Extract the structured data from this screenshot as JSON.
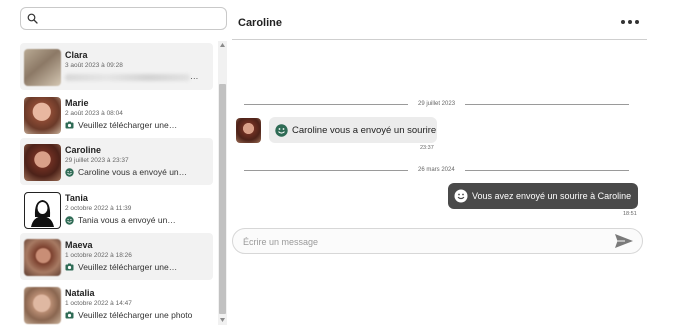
{
  "search": {
    "placeholder": ""
  },
  "conversations": [
    {
      "name": "Clara",
      "date": "3 août 2023 à 09:28",
      "preview": "…",
      "preview_icon": "none",
      "blurred": true,
      "avatar": "photo"
    },
    {
      "name": "Marie",
      "date": "2 août 2023 à 08:04",
      "preview": "Veuillez télécharger une…",
      "preview_icon": "camera-icon",
      "avatar": "photo"
    },
    {
      "name": "Caroline",
      "date": "29 juillet 2023 à 23:37",
      "preview": "Caroline vous a envoyé un…",
      "preview_icon": "smiley-icon",
      "avatar": "photo"
    },
    {
      "name": "Tania",
      "date": "2 octobre 2022 à 11:39",
      "preview": "Tania vous a envoyé un…",
      "preview_icon": "smiley-icon",
      "avatar": "default-silhouette"
    },
    {
      "name": "Maeva",
      "date": "1 octobre 2022 à 18:26",
      "preview": "Veuillez télécharger une…",
      "preview_icon": "camera-icon",
      "avatar": "photo"
    },
    {
      "name": "Natalia",
      "date": "1 octobre 2022 à 14:47",
      "preview": "Veuillez télécharger une photo",
      "preview_icon": "camera-icon",
      "avatar": "photo"
    }
  ],
  "chat": {
    "title": "Caroline",
    "menu_icon": "more-horizontal-icon",
    "separators": [
      "29 juillet 2023",
      "26 mars 2024"
    ],
    "messages": [
      {
        "direction": "incoming",
        "icon": "smiley-icon",
        "text": "Caroline vous a envoyé un sourire",
        "time": "23:37"
      },
      {
        "direction": "outgoing",
        "icon": "smiley-icon",
        "text": "Vous avez envoyé un sourire à Caroline",
        "time": "18:51"
      }
    ],
    "composer": {
      "placeholder": "Écrire un message",
      "send_icon": "send-icon"
    }
  },
  "colors": {
    "accent": "#2f6b55",
    "outgoing_bubble": "#4a4a4a",
    "incoming_bubble": "#ececec"
  }
}
